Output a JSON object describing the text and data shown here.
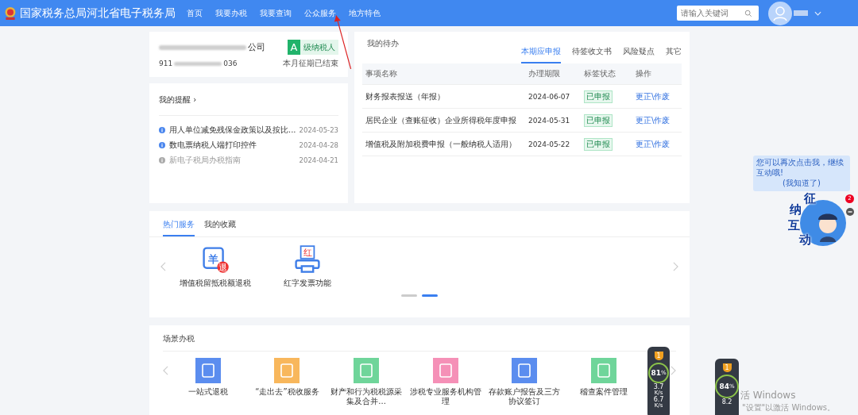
{
  "header": {
    "title": "国家税务总局河北省电子税务局",
    "nav": [
      {
        "label": "首页",
        "selected": false
      },
      {
        "label": "我要办税",
        "selected": false
      },
      {
        "label": "我要查询",
        "selected": false
      },
      {
        "label": "公众服务",
        "selected": false
      },
      {
        "label": "地方特色",
        "selected": false
      }
    ],
    "search": {
      "placeholder": "请输入关键词"
    }
  },
  "company": {
    "name_end": "公司",
    "tax_id_start": "911",
    "tax_id_end": "036",
    "grade": "A",
    "grade_label": "级纳税人",
    "status": "本月征期已结束"
  },
  "reminders": {
    "title": "我的提醒 ›",
    "items": [
      {
        "text": "用人单位减免残保金政策以及按比...",
        "date": "2024-05-23",
        "read": false
      },
      {
        "text": "数电票纳税人端打印控件",
        "date": "2024-04-28",
        "read": false
      },
      {
        "text": "新电子税局办税指南",
        "date": "2024-04-21",
        "read": true
      }
    ]
  },
  "todo": {
    "title": "我的待办",
    "tabs": [
      {
        "label": "本期应申报",
        "selected": true
      },
      {
        "label": "待签收文书",
        "selected": false
      },
      {
        "label": "风险疑点",
        "selected": false
      },
      {
        "label": "其它",
        "selected": false
      }
    ],
    "columns": [
      "事项名称",
      "办理期限",
      "标签状态",
      "操作"
    ],
    "rows": [
      {
        "name": "财务报表报送（年报）",
        "deadline": "2024-06-07",
        "status": "已申报",
        "action": "更正\\作废"
      },
      {
        "name": "居民企业（查账征收）企业所得税年度申报",
        "deadline": "2024-05-31",
        "status": "已申报",
        "action": "更正\\作废"
      },
      {
        "name": "增值税及附加税费申报（一般纳税人适用）",
        "deadline": "2024-05-22",
        "status": "已申报",
        "action": "更正\\作废"
      }
    ]
  },
  "hot": {
    "tabs": [
      {
        "label": "热门服务",
        "selected": true
      },
      {
        "label": "我的收藏",
        "selected": false
      }
    ],
    "items": [
      {
        "label": "增值税留抵税额退税",
        "kind": "refund",
        "mark": "羊",
        "badge": "退"
      },
      {
        "label": "红字发票功能",
        "kind": "printer",
        "mark": "红"
      }
    ],
    "pages": [
      {
        "selected": false
      },
      {
        "selected": true
      }
    ]
  },
  "scene": {
    "title": "场景办税",
    "items": [
      {
        "label": "一站式退税",
        "color": "#5b8def"
      },
      {
        "label": "“走出去”税收服务",
        "color": "#f8b75c"
      },
      {
        "label": "财产和行为税税源采集及合并...",
        "color": "#6fd59a"
      },
      {
        "label": "涉税专业服务机构管理",
        "color": "#f590b7"
      },
      {
        "label": "存款账户报告及三方协议签订",
        "color": "#5b8def"
      },
      {
        "label": "稽查案件管理",
        "color": "#6fd59a"
      }
    ]
  },
  "assistant": {
    "bubble": "您可以再次点击我，继续互动哦!",
    "link": "(我知道了)",
    "chars": [
      "征",
      "纳",
      "互",
      "动"
    ],
    "badge": "2"
  },
  "speed_widgets": [
    {
      "rank": "1",
      "percent": "81",
      "unit": "%",
      "rates": [
        {
          "value": "3.7",
          "unit": "K/s"
        },
        {
          "value": "6.7",
          "unit": "K/s"
        }
      ]
    },
    {
      "rank": "1",
      "percent": "84",
      "unit": "%",
      "rates": [
        {
          "value": "8.2"
        }
      ]
    }
  ],
  "os_notice": [
    "活 Windows",
    "\"设置\"以激活 Windows。"
  ]
}
